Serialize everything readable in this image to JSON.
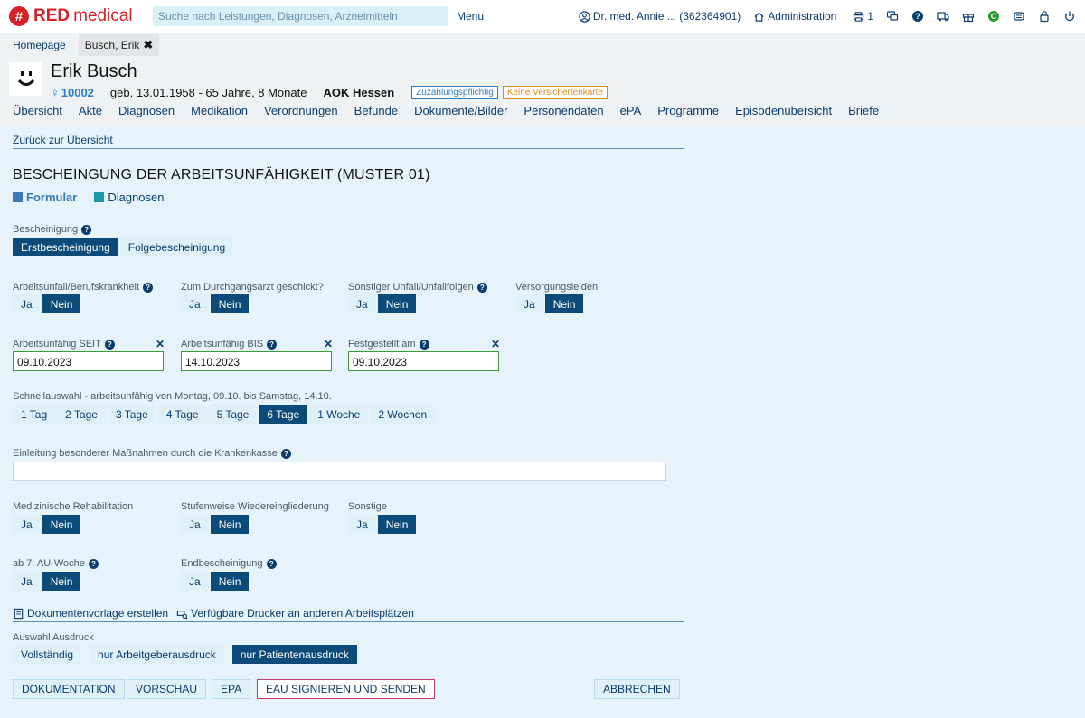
{
  "topbar": {
    "logo_red": "RED",
    "logo_medical": "medical",
    "search_placeholder": "Suche nach Leistungen, Diagnosen, Arzneimitteln",
    "menu_label": "Menu",
    "user_label": "Dr. med. Annie ... (362364901)",
    "admin_label": "Administration",
    "print_count": "1"
  },
  "tabs": [
    {
      "label": "Homepage"
    },
    {
      "label": "Busch, Erik"
    }
  ],
  "patient": {
    "name": "Erik Busch",
    "id": "10002",
    "birth": "geb. 13.01.1958 - 65 Jahre, 8 Monate",
    "insurance": "AOK Hessen",
    "badge_copay": "Zuzahlungspflichtig",
    "badge_card": "Keine Versichertenkarte",
    "nav": [
      "Übersicht",
      "Akte",
      "Diagnosen",
      "Medikation",
      "Verordnungen",
      "Befunde",
      "Dokumente/Bilder",
      "Personendaten",
      "ePA",
      "Programme",
      "Episodenübersicht",
      "Briefe"
    ]
  },
  "form": {
    "back_link": "Zurück zur Übersicht",
    "title": "BESCHEINGUNG DER ARBEITSUNFÄHIGKEIT (MUSTER 01)",
    "subtab_form": "Formular",
    "subtab_diag": "Diagnosen",
    "bescheinigung_label": "Bescheinigung",
    "erst": "Erstbescheinigung",
    "folge": "Folgebescheinigung",
    "unfall_label": "Arbeitsunfall/Berufskrankheit",
    "durchgang_label": "Zum Durchgangsarzt geschickt?",
    "sonstiger_label": "Sonstiger Unfall/Unfallfolgen",
    "versorgung_label": "Versorgungsleiden",
    "ja": "Ja",
    "nein": "Nein",
    "seit_label": "Arbeitsunfähig SEIT",
    "bis_label": "Arbeitsunfähig BIS",
    "festgestellt_label": "Festgestellt am",
    "seit_value": "09.10.2023",
    "bis_value": "14.10.2023",
    "festgestellt_value": "09.10.2023",
    "schnell_label": "Schnellauswahl - arbeitsunfähig von Montag, 09.10. bis Samstag, 14.10.",
    "schnell_options": [
      "1 Tag",
      "2 Tage",
      "3 Tage",
      "4 Tage",
      "5 Tage",
      "6 Tage",
      "1 Woche",
      "2 Wochen"
    ],
    "einleitung_label": "Einleitung besonderer Maßnahmen durch die Krankenkasse",
    "reha_label": "Medizinische Rehabilitation",
    "stufen_label": "Stufenweise Wiedereingliederung",
    "sonstige_label": "Sonstige",
    "au7_label": "ab 7. AU-Woche",
    "end_label": "Endbescheinigung",
    "vorlage_link": "Dokumentenvorlage erstellen",
    "drucker_link": "Verfügbare Drucker an anderen Arbeitsplätzen",
    "ausdruck_label": "Auswahl Ausdruck",
    "ausdruck_options": [
      "Vollständig",
      "nur Arbeitgeberausdruck",
      "nur Patientenausdruck"
    ],
    "btn_doku": "DOKUMENTATION",
    "btn_vorschau": "VORSCHAU",
    "btn_epa": "EPA",
    "btn_eau": "EAU SIGNIEREN UND SENDEN",
    "btn_abbrechen": "ABBRECHEN"
  },
  "colors": {
    "brand_red": "#d62027",
    "selected_dark_blue": "#0b4b7a",
    "link_blue": "#0a3c6e",
    "formular_tab": "#3d78b8",
    "diagnosen_tab": "#1a9aa8"
  }
}
